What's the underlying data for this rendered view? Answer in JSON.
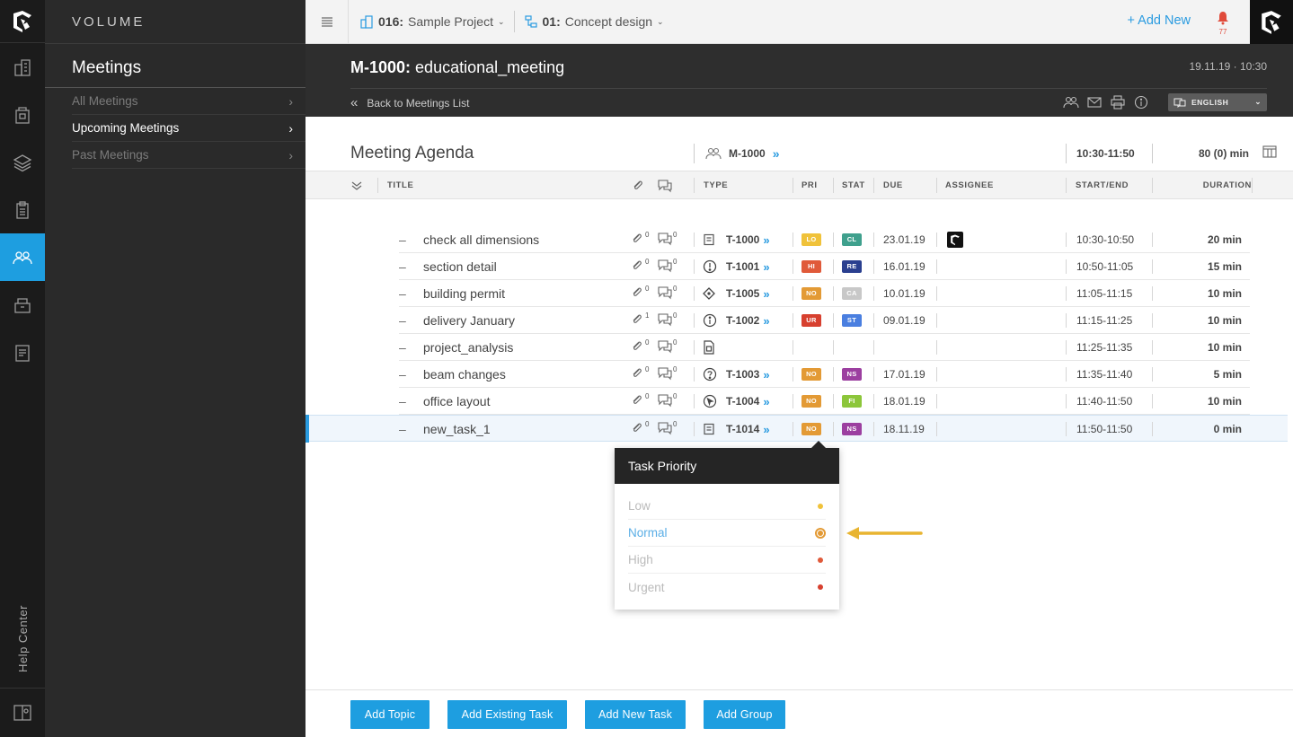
{
  "rail": {
    "icons": [
      "projects-icon",
      "buildings-icon",
      "layers-icon",
      "clipboard-icon",
      "meetings-icon",
      "archive-icon",
      "reports-icon"
    ],
    "active_index": 4,
    "help_label": "Help Center"
  },
  "sidebar": {
    "brand": "VOLUME",
    "heading": "Meetings",
    "items": [
      {
        "label": "All Meetings"
      },
      {
        "label": "Upcoming Meetings"
      },
      {
        "label": "Past Meetings"
      }
    ]
  },
  "topbar": {
    "project_code": "016:",
    "project_name": "Sample Project",
    "phase_code": "01:",
    "phase_name": "Concept design",
    "add_new": "+ Add New",
    "notification_count": "77"
  },
  "meeting": {
    "id": "M-1000:",
    "name": "educational_meeting",
    "datetime": "19.11.19 · 10:30",
    "back_label": "Back to Meetings List",
    "language": "ENGLISH"
  },
  "agenda": {
    "title": "Meeting Agenda",
    "meeting_ref": "M-1000",
    "time_range": "10:30-11:50",
    "total_duration": "80 (0) min"
  },
  "columns": {
    "title": "TITLE",
    "type": "TYPE",
    "pri": "PRI",
    "stat": "STAT",
    "due": "DUE",
    "assignee": "ASSIGNEE",
    "start_end": "START/END",
    "duration": "DURATION"
  },
  "rows": [
    {
      "title": "check all dimensions",
      "links": "0",
      "comments": "0",
      "type_icon": "document-icon",
      "task_id": "T-1000",
      "pri": "LO",
      "pri_color": "#f0c23a",
      "stat": "CL",
      "stat_color": "#3fa08d",
      "due": "23.01.19",
      "assignee": "avatar",
      "time": "10:30-10:50",
      "duration": "20 min"
    },
    {
      "title": "section detail",
      "links": "0",
      "comments": "0",
      "type_icon": "alert-icon",
      "task_id": "T-1001",
      "pri": "HI",
      "pri_color": "#e05a3a",
      "stat": "RE",
      "stat_color": "#2a3f8f",
      "due": "16.01.19",
      "time": "10:50-11:05",
      "duration": "15 min"
    },
    {
      "title": "building permit",
      "links": "0",
      "comments": "0",
      "type_icon": "diamond-icon",
      "task_id": "T-1005",
      "pri": "NO",
      "pri_color": "#e39a35",
      "stat": "CA",
      "stat_color": "#c8c8c8",
      "due": "10.01.19",
      "time": "11:05-11:15",
      "duration": "10 min"
    },
    {
      "title": "delivery January",
      "links": "1",
      "comments": "0",
      "type_icon": "info-icon",
      "task_id": "T-1002",
      "pri": "UR",
      "pri_color": "#d7402f",
      "stat": "ST",
      "stat_color": "#4a7fe0",
      "due": "09.01.19",
      "time": "11:15-11:25",
      "duration": "10 min"
    },
    {
      "title": "project_analysis",
      "links": "0",
      "comments": "0",
      "type_icon": "file-icon",
      "task_id": "",
      "pri": "",
      "stat": "",
      "due": "",
      "time": "11:25-11:35",
      "duration": "10 min"
    },
    {
      "title": "beam changes",
      "links": "0",
      "comments": "0",
      "type_icon": "question-icon",
      "task_id": "T-1003",
      "pri": "NO",
      "pri_color": "#e39a35",
      "stat": "NS",
      "stat_color": "#9c3fa0",
      "due": "17.01.19",
      "time": "11:35-11:40",
      "duration": "5 min"
    },
    {
      "title": "office layout",
      "links": "0",
      "comments": "0",
      "type_icon": "cursor-icon",
      "task_id": "T-1004",
      "pri": "NO",
      "pri_color": "#e39a35",
      "stat": "FI",
      "stat_color": "#8cc63a",
      "due": "18.01.19",
      "time": "11:40-11:50",
      "duration": "10 min"
    },
    {
      "title": "new_task_1",
      "links": "0",
      "comments": "0",
      "type_icon": "document-icon",
      "task_id": "T-1014",
      "pri": "NO",
      "pri_color": "#e39a35",
      "stat": "NS",
      "stat_color": "#9c3fa0",
      "due": "18.11.19",
      "time": "11:50-11:50",
      "duration": "0 min",
      "selected": true
    }
  ],
  "popover": {
    "title": "Task Priority",
    "options": [
      {
        "label": "Low",
        "color": "#f0c23a"
      },
      {
        "label": "Normal",
        "color": "#e39a35",
        "selected": true
      },
      {
        "label": "High",
        "color": "#e05a3a"
      },
      {
        "label": "Urgent",
        "color": "#d7402f"
      }
    ]
  },
  "footer": {
    "buttons": [
      "Add Topic",
      "Add Existing Task",
      "Add New Task",
      "Add Group"
    ]
  }
}
